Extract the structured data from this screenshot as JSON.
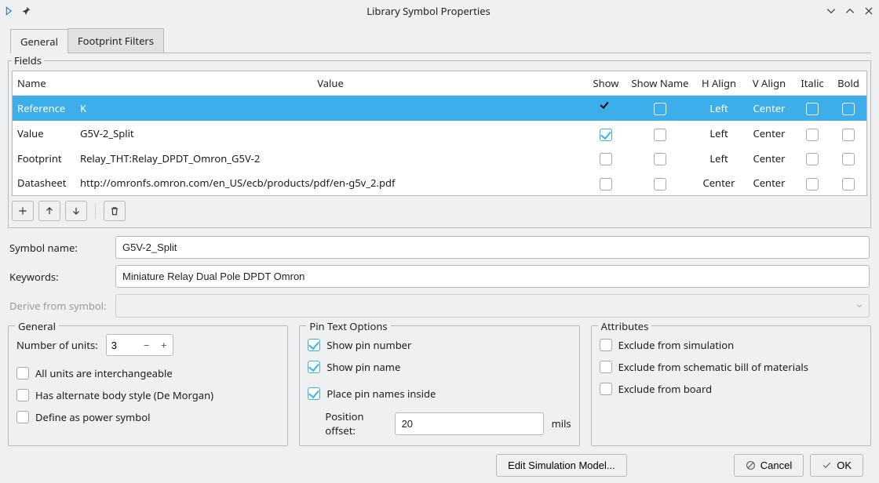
{
  "window": {
    "title": "Library Symbol Properties"
  },
  "tabs": {
    "general": "General",
    "footprint_filters": "Footprint Filters"
  },
  "fields_section": {
    "legend": "Fields",
    "headers": {
      "name": "Name",
      "value": "Value",
      "show": "Show",
      "show_name": "Show Name",
      "h_align": "H Align",
      "v_align": "V Align",
      "italic": "Italic",
      "bold": "Bold"
    },
    "rows": [
      {
        "name": "Reference",
        "value": "K",
        "show": true,
        "show_name": false,
        "h_align": "Left",
        "v_align": "Center",
        "italic": false,
        "bold": false,
        "selected": true
      },
      {
        "name": "Value",
        "value": "G5V-2_Split",
        "show": true,
        "show_name": false,
        "h_align": "Left",
        "v_align": "Center",
        "italic": false,
        "bold": false,
        "selected": false
      },
      {
        "name": "Footprint",
        "value": "Relay_THT:Relay_DPDT_Omron_G5V-2",
        "show": false,
        "show_name": false,
        "h_align": "Left",
        "v_align": "Center",
        "italic": false,
        "bold": false,
        "selected": false
      },
      {
        "name": "Datasheet",
        "value": "http://omronfs.omron.com/en_US/ecb/products/pdf/en-g5v_2.pdf",
        "show": false,
        "show_name": false,
        "h_align": "Center",
        "v_align": "Center",
        "italic": false,
        "bold": false,
        "selected": false
      }
    ]
  },
  "labels": {
    "symbol_name": "Symbol name:",
    "keywords": "Keywords:",
    "derive_from": "Derive from symbol:"
  },
  "values": {
    "symbol_name": "G5V-2_Split",
    "keywords": "Miniature Relay Dual Pole DPDT Omron",
    "derive_from": ""
  },
  "general_group": {
    "title": "General",
    "number_of_units_label": "Number of units:",
    "number_of_units_value": "3",
    "all_units_interchangeable": "All units are interchangeable",
    "has_alternate_body": "Has alternate body style (De Morgan)",
    "define_power_symbol": "Define as power symbol"
  },
  "pin_group": {
    "title": "Pin Text Options",
    "show_pin_number": "Show pin number",
    "show_pin_name": "Show pin name",
    "place_pin_names_inside": "Place pin names inside",
    "position_offset_label": "Position offset:",
    "position_offset_value": "20",
    "position_offset_unit": "mils"
  },
  "attr_group": {
    "title": "Attributes",
    "exclude_sim": "Exclude from simulation",
    "exclude_bom": "Exclude from schematic bill of materials",
    "exclude_board": "Exclude from board"
  },
  "buttons": {
    "edit_sim": "Edit Simulation Model...",
    "cancel": "Cancel",
    "ok": "OK"
  }
}
